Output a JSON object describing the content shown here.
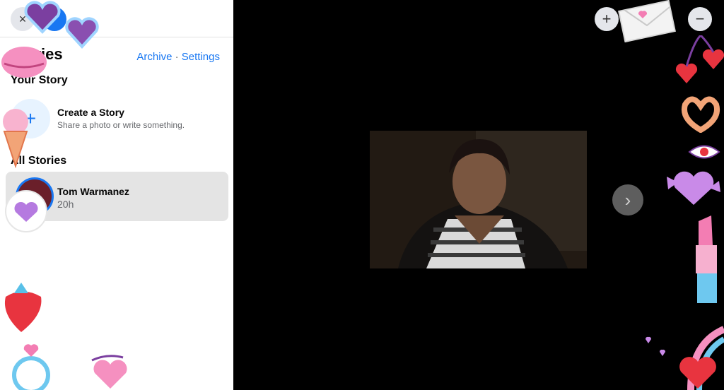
{
  "sidebar": {
    "title": "Stories",
    "links": {
      "archive": "Archive",
      "separator": "·",
      "settings": "Settings"
    },
    "your_story": {
      "heading": "Your Story",
      "create_title": "Create a Story",
      "create_subtitle": "Share a photo or write something."
    },
    "all_stories": {
      "heading": "All Stories",
      "items": [
        {
          "name": "Tom Warmanez",
          "time": "20h"
        }
      ]
    }
  },
  "viewer": {
    "next_icon": "›",
    "add_icon": "+",
    "minus_icon": "−"
  },
  "icons": {
    "close": "×",
    "plus": "+"
  },
  "colors": {
    "accent": "#1877f2",
    "viewer_bg": "#000000",
    "selected_row": "#e4e4e4",
    "sticker_pink": "#f06aa8",
    "sticker_purple": "#9b5fd6",
    "sticker_red": "#e8343f"
  }
}
